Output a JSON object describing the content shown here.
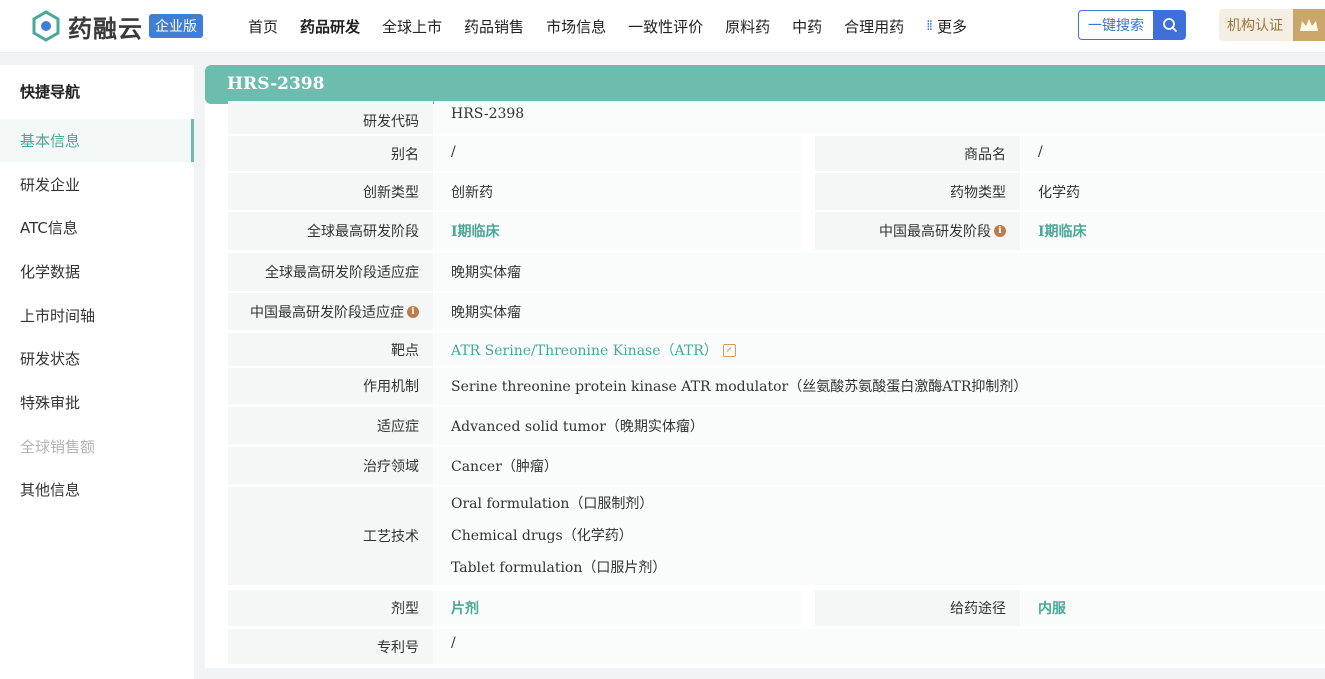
{
  "header": {
    "logo_text": "药融云",
    "logo_badge": "企业版",
    "nav": [
      "首页",
      "药品研发",
      "全球上市",
      "药品销售",
      "市场信息",
      "一致性评价",
      "原料药",
      "中药",
      "合理用药"
    ],
    "nav_more": "更多",
    "search_label": "一键搜索",
    "cert_label": "机构认证"
  },
  "sidebar": {
    "title": "快捷导航",
    "items": [
      "基本信息",
      "研发企业",
      "ATC信息",
      "化学数据",
      "上市时间轴",
      "研发状态",
      "特殊审批",
      "全球销售额",
      "其他信息"
    ]
  },
  "main": {
    "title": "HRS-2398",
    "fields": {
      "dev_code_label": "研发代码",
      "dev_code": "HRS-2398",
      "alias_label": "别名",
      "alias": "/",
      "trade_name_label": "商品名",
      "trade_name": "/",
      "innovation_label": "创新类型",
      "innovation": "创新药",
      "drug_type_label": "药物类型",
      "drug_type": "化学药",
      "global_stage_label": "全球最高研发阶段",
      "global_stage": "I期临床",
      "china_stage_label": "中国最高研发阶段",
      "china_stage": "I期临床",
      "global_indication_label": "全球最高研发阶段适应症",
      "global_indication": "晚期实体瘤",
      "china_indication_label": "中国最高研发阶段适应症",
      "china_indication": "晚期实体瘤",
      "target_label": "靶点",
      "target": "ATR Serine/Threonine Kinase（ATR）",
      "mechanism_label": "作用机制",
      "mechanism": "Serine threonine protein kinase ATR modulator（丝氨酸苏氨酸蛋白激酶ATR抑制剂）",
      "indication_label": "适应症",
      "indication": "Advanced solid tumor（晚期实体瘤）",
      "therapy_area_label": "治疗领域",
      "therapy_area": "Cancer（肿瘤）",
      "tech_label": "工艺技术",
      "tech": [
        "Oral formulation（口服制剂）",
        "Chemical drugs（化学药）",
        "Tablet formulation（口服片剂）"
      ],
      "dosage_form_label": "剂型",
      "dosage_form": "片剂",
      "route_label": "给药途径",
      "route": "内服",
      "patent_label": "专利号",
      "patent": "/"
    }
  }
}
